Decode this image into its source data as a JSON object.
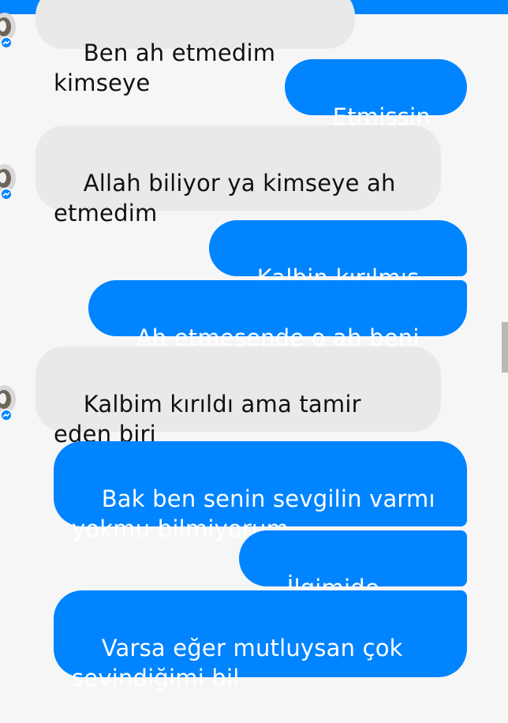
{
  "messages": [
    {
      "side": "in",
      "text": "Ben ah etmedim kimseye"
    },
    {
      "side": "out",
      "text": "Etmişsin işte"
    },
    {
      "side": "in",
      "text": "Allah biliyor ya kimseye ah\netmedim"
    },
    {
      "side": "out",
      "text": "Kalbin kırılmış buse"
    },
    {
      "side": "out",
      "text": "Ah etmesende o ah beni buldu"
    },
    {
      "side": "in",
      "text": "Kalbim kırıldı ama tamir eden biri\nçıktı merak etme"
    },
    {
      "side": "out",
      "text": "Bak ben senin sevgilin varmı\nyokmu bilmiyorum"
    },
    {
      "side": "out",
      "text": "İlgimide çekmiyo"
    },
    {
      "side": "out",
      "text": "Varsa eğer mutluysan çok\nsevindiğimi bil"
    }
  ],
  "colors": {
    "outgoing": "#0084ff",
    "incoming": "#e9e9e9",
    "background": "#f6f6f6"
  },
  "icons": {
    "avatar": "contact-avatar",
    "badge": "messenger-badge-icon"
  }
}
